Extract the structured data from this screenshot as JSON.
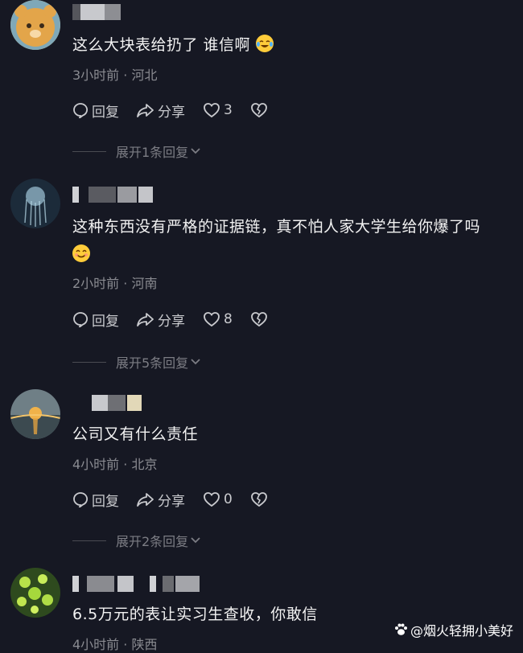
{
  "comments": [
    {
      "text": "这么大块表给扔了 谁信啊",
      "emoji": "laughing-crying-emoji",
      "time": "3小时前",
      "location": "河北",
      "reply_label": "回复",
      "share_label": "分享",
      "likes": "3",
      "expand_label": "展开1条回复"
    },
    {
      "text": "这种东西没有严格的证据链，真不怕人家大学生给你爆了吗",
      "emoji": "smiling-emoji",
      "time": "2小时前",
      "location": "河南",
      "reply_label": "回复",
      "share_label": "分享",
      "likes": "8",
      "expand_label": "展开5条回复"
    },
    {
      "text": "公司又有什么责任",
      "time": "4小时前",
      "location": "北京",
      "reply_label": "回复",
      "share_label": "分享",
      "likes": "0",
      "expand_label": "展开2条回复"
    },
    {
      "text": "6.5万元的表让实习生查收，你敢信",
      "time": "4小时前",
      "location": "陕西"
    }
  ],
  "meta_separator": "·",
  "watermark": "@烟火轻拥小美好",
  "icons": {
    "reply": "comment-bubble-icon",
    "share": "share-arrow-icon",
    "like": "heart-icon",
    "dislike": "broken-heart-icon",
    "expand": "chevron-down-icon",
    "watermark_logo": "paw-icon"
  },
  "colors": {
    "background": "#161823",
    "text": "#f2f2f2",
    "meta": "#8a8b91"
  }
}
